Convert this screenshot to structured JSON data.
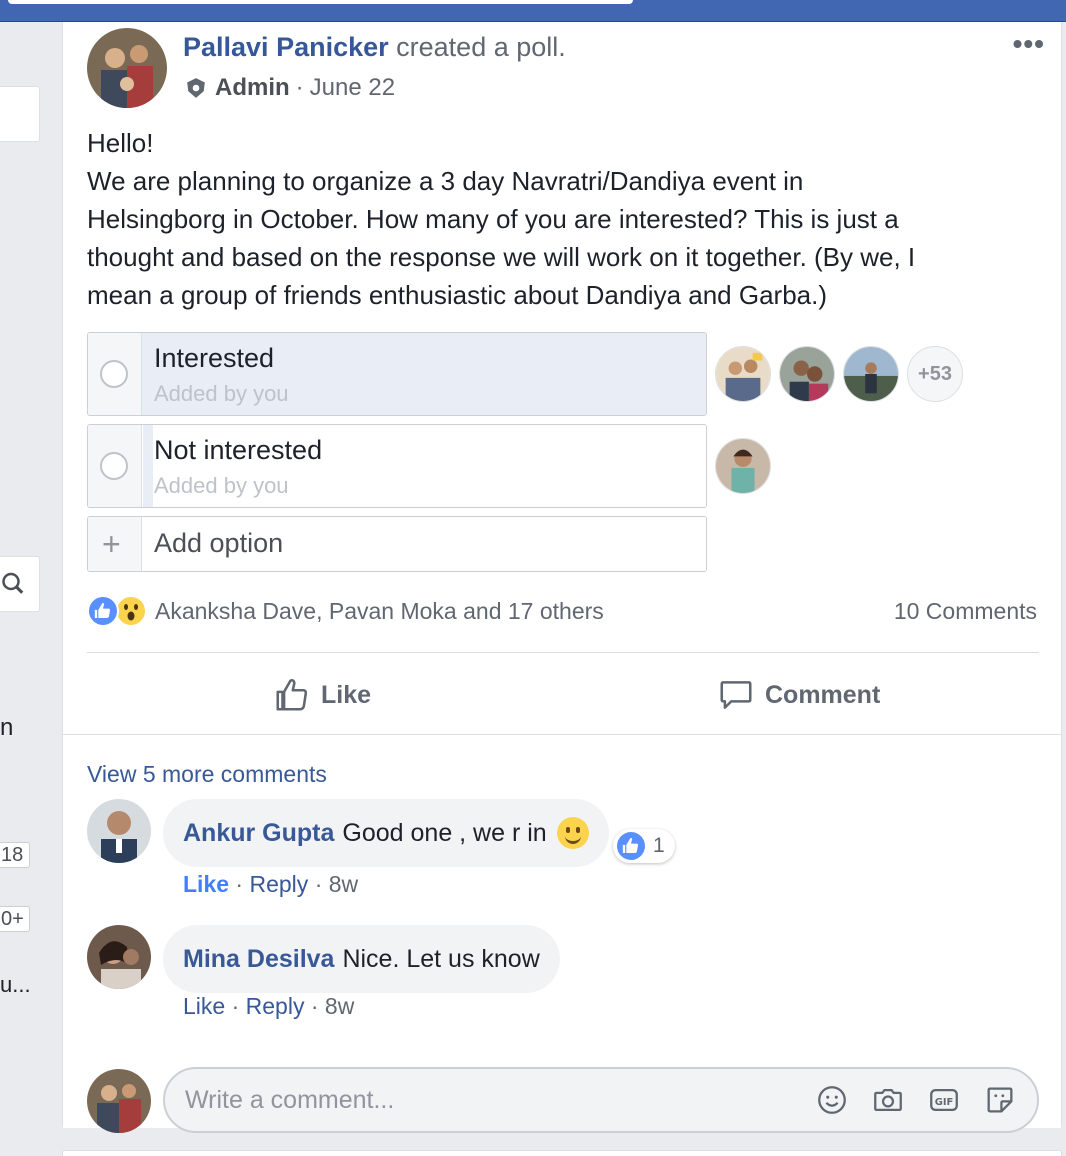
{
  "post": {
    "author": "Pallavi Panicker",
    "action": "created a poll.",
    "role": "Admin",
    "date": "June 22",
    "text_lines": [
      "Hello!",
      "We are planning to organize a 3 day Navratri/Dandiya event in",
      "Helsingborg in October. How many of you are interested? This is just a",
      "thought and based on the response we will work on it together. (By we, I",
      "mean a group of friends enthusiastic about Dandiya and Garba.)"
    ]
  },
  "poll": {
    "options": [
      {
        "label": "Interested",
        "sub": "Added by you",
        "votes_more": "+53"
      },
      {
        "label": "Not interested",
        "sub": "Added by you"
      }
    ],
    "add_option": "Add option"
  },
  "reactions": {
    "names": "Akanksha Dave, Pavan Moka and 17 others",
    "comments": "10 Comments"
  },
  "actions": {
    "like": "Like",
    "comment": "Comment"
  },
  "comments": {
    "view_more": "View 5 more comments",
    "items": [
      {
        "name": "Ankur Gupta",
        "text": "Good one , we r in",
        "likes": "1",
        "like": "Like",
        "reply": "Reply",
        "time": "8w"
      },
      {
        "name": "Mina Desilva",
        "text": "Nice. Let us know",
        "like": "Like",
        "reply": "Reply",
        "time": "8w"
      }
    ],
    "placeholder": "Write a comment..."
  },
  "sidebar": {
    "fragment_n": "n",
    "badge1": "18",
    "badge2": "0+",
    "fragment_u": "u..."
  },
  "colors": {
    "brand": "#4267b2",
    "link": "#385898",
    "like_blue": "#5890ff"
  }
}
